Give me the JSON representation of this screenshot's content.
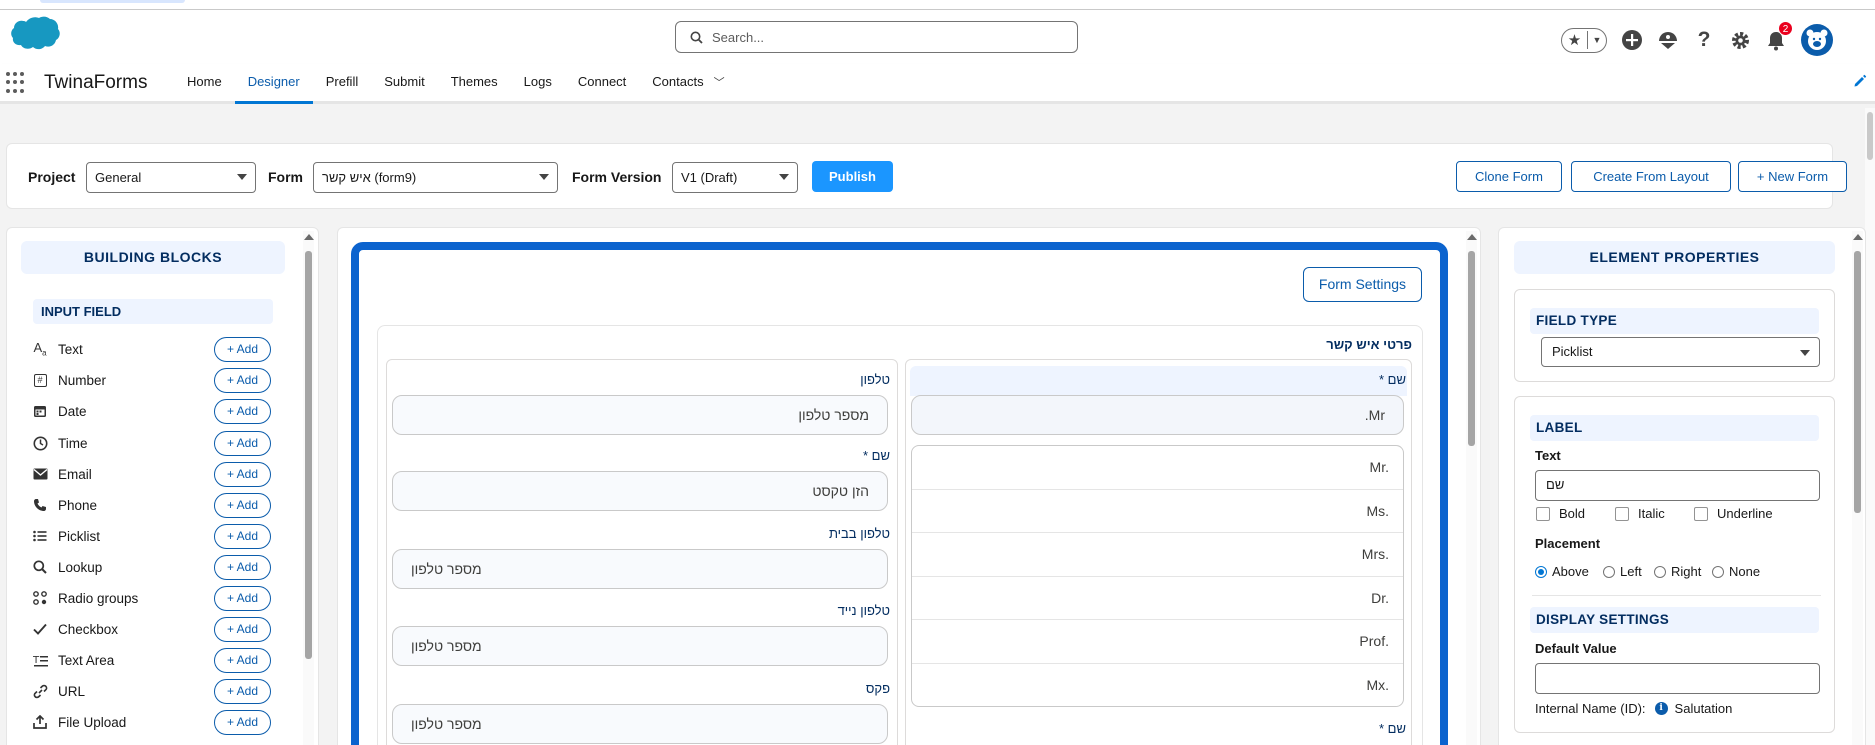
{
  "header": {
    "search_placeholder": "Search...",
    "notification_count": "2"
  },
  "nav": {
    "app_name": "TwinaForms",
    "items": [
      {
        "label": "Home",
        "active": false
      },
      {
        "label": "Designer",
        "active": true
      },
      {
        "label": "Prefill",
        "active": false
      },
      {
        "label": "Submit",
        "active": false
      },
      {
        "label": "Themes",
        "active": false
      },
      {
        "label": "Logs",
        "active": false
      },
      {
        "label": "Connect",
        "active": false
      },
      {
        "label": "Contacts",
        "active": false
      }
    ]
  },
  "toolbar": {
    "project_label": "Project",
    "project_value": "General",
    "form_label": "Form",
    "form_value": "איש קשר (form9)",
    "version_label": "Form Version",
    "version_value": "V1 (Draft)",
    "publish_label": "Publish",
    "clone_label": "Clone Form",
    "create_layout_label": "Create From Layout",
    "new_form_label": "+ New Form"
  },
  "building_blocks": {
    "title": "BUILDING BLOCKS",
    "section_title": "INPUT FIELD",
    "add_label": "+ Add",
    "items": [
      {
        "label": "Text",
        "icon": "text-icon"
      },
      {
        "label": "Number",
        "icon": "number-icon"
      },
      {
        "label": "Date",
        "icon": "calendar-icon"
      },
      {
        "label": "Time",
        "icon": "clock-icon"
      },
      {
        "label": "Email",
        "icon": "email-icon"
      },
      {
        "label": "Phone",
        "icon": "phone-icon"
      },
      {
        "label": "Picklist",
        "icon": "list-icon"
      },
      {
        "label": "Lookup",
        "icon": "search-icon"
      },
      {
        "label": "Radio groups",
        "icon": "radio-groups-icon"
      },
      {
        "label": "Checkbox",
        "icon": "check-icon"
      },
      {
        "label": "Text Area",
        "icon": "text-area-icon"
      },
      {
        "label": "URL",
        "icon": "link-icon"
      },
      {
        "label": "File Upload",
        "icon": "upload-icon"
      }
    ]
  },
  "canvas": {
    "form_settings_label": "Form Settings",
    "section_title": "פרטי איש קשר",
    "left_column": [
      {
        "label": "טלפון",
        "placeholder": "מספר טלפון"
      },
      {
        "label": "שם *",
        "placeholder": "הזן טקסט"
      },
      {
        "label": "טלפון בבית",
        "placeholder": "מספר טלפון"
      },
      {
        "label": "טלפון נייד",
        "placeholder": "מספר טלפון"
      },
      {
        "label": "פקס",
        "placeholder": "מספר טלפון"
      }
    ],
    "right_column": {
      "label": "שם *",
      "selected_value": "Mr.",
      "options": [
        "Mr.",
        "Ms.",
        "Mrs.",
        "Dr.",
        "Prof.",
        "Mx."
      ],
      "next_label": "שם *"
    }
  },
  "properties": {
    "title": "ELEMENT PROPERTIES",
    "field_type_title": "FIELD TYPE",
    "field_type_value": "Picklist",
    "label_title": "LABEL",
    "text_label": "Text",
    "text_value": "שם",
    "bold_label": "Bold",
    "italic_label": "Italic",
    "underline_label": "Underline",
    "placement_label": "Placement",
    "placement_options": [
      {
        "label": "Above",
        "selected": true
      },
      {
        "label": "Left",
        "selected": false
      },
      {
        "label": "Right",
        "selected": false
      },
      {
        "label": "None",
        "selected": false
      }
    ],
    "display_title": "DISPLAY SETTINGS",
    "default_value_label": "Default Value",
    "default_value": "",
    "internal_name_label": "Internal Name (ID):",
    "internal_name_value": "Salutation"
  },
  "colors": {
    "brand": "#0176d3",
    "frame": "#0b63ce",
    "publish": "#1b96ff",
    "badge": "#ea001e"
  }
}
